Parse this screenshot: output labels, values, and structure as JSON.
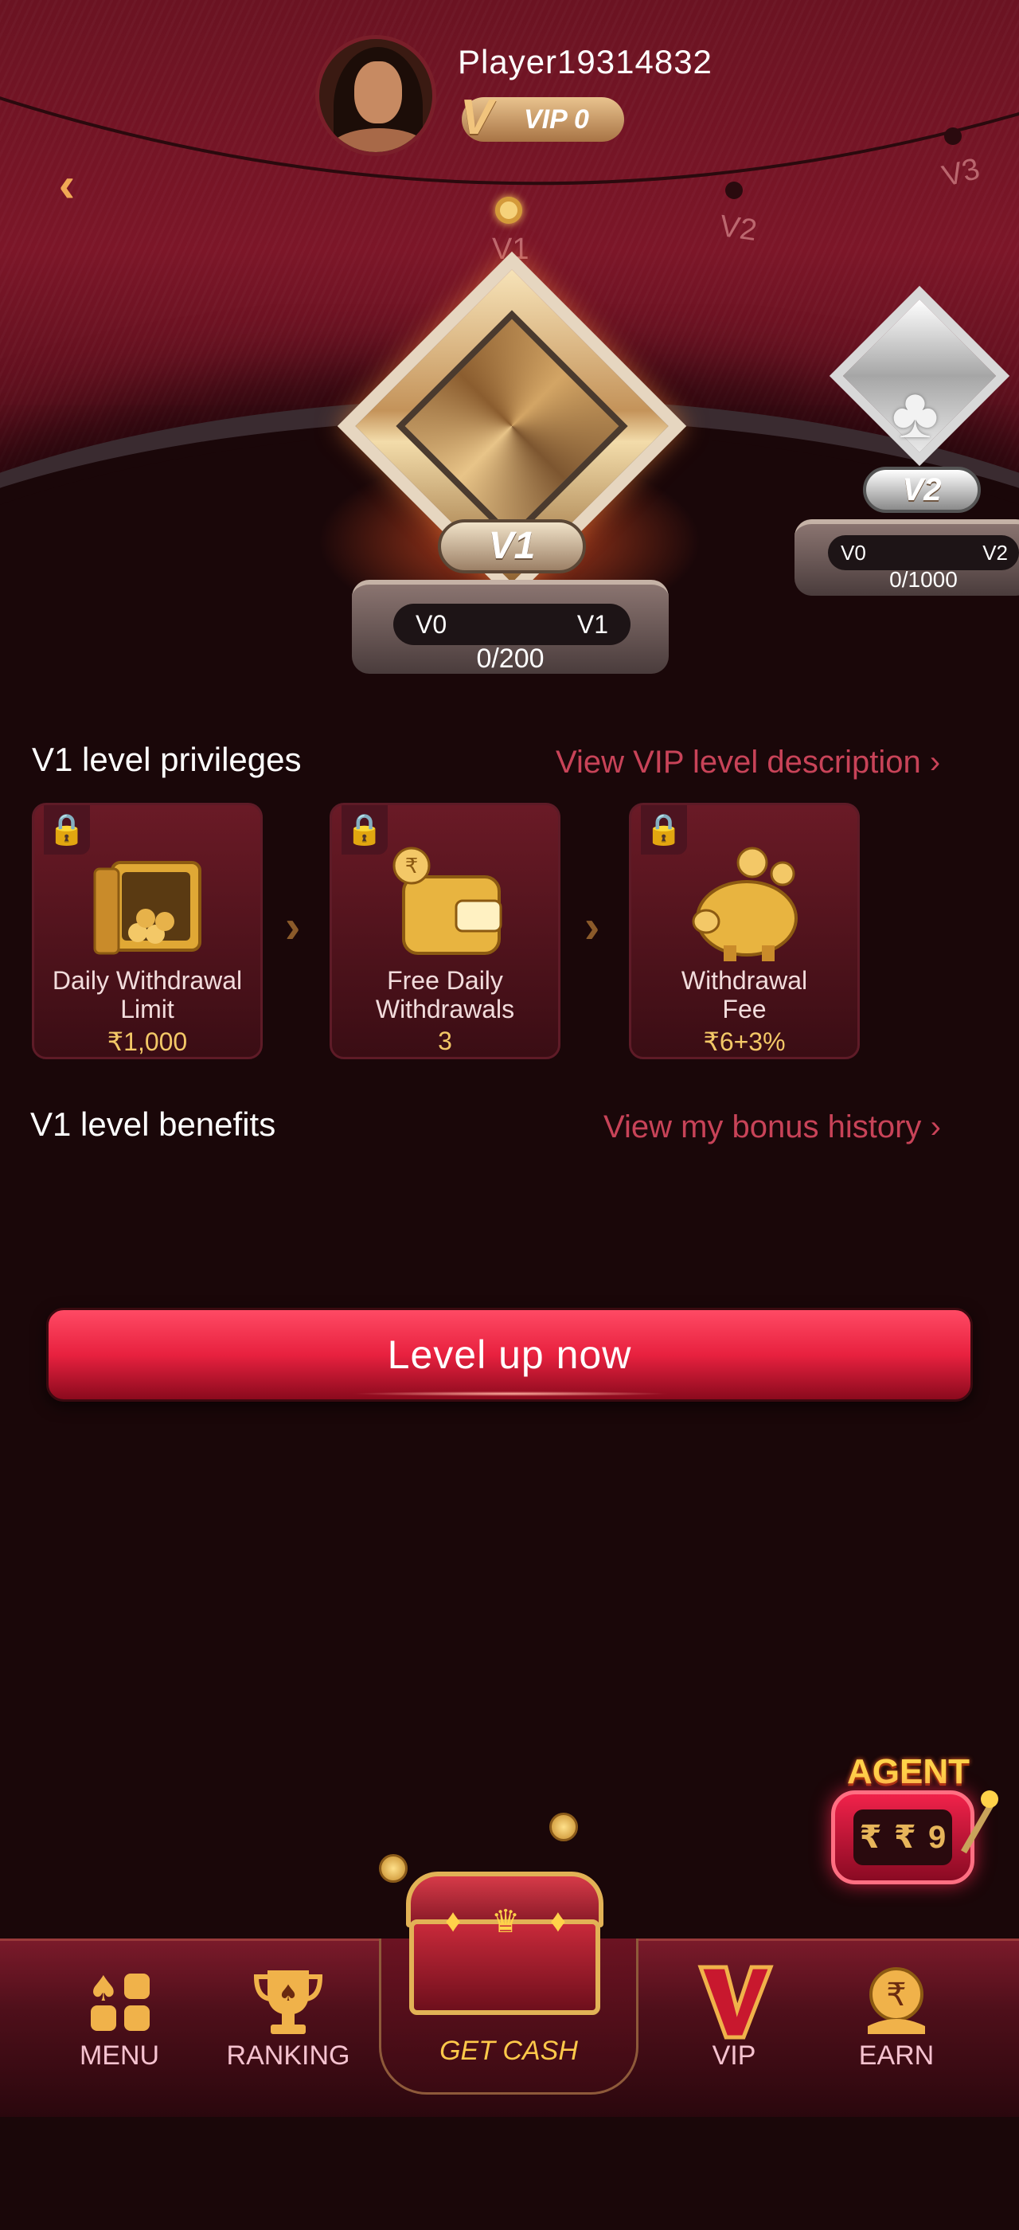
{
  "profile": {
    "username": "Player19314832",
    "vip_badge": "VIP 0",
    "vip_letter": "V"
  },
  "level_track": {
    "levels": [
      "V1",
      "V2",
      "V3"
    ],
    "current": "V1"
  },
  "current_level_card": {
    "badge": "V1",
    "from": "V0",
    "to": "V1",
    "progress": "0/200"
  },
  "next_level_card": {
    "badge": "V2",
    "from": "V0",
    "to": "V2",
    "progress": "0/1000"
  },
  "privileges": {
    "title": "V1 level privileges",
    "link": "View VIP level description",
    "items": [
      {
        "name_line1": "Daily Withdrawal",
        "name_line2": "Limit",
        "value": "₹1,000",
        "icon": "gold-safe-icon"
      },
      {
        "name_line1": "Free Daily",
        "name_line2": "Withdrawals",
        "value": "3",
        "icon": "gold-wallet-icon"
      },
      {
        "name_line1": "Withdrawal",
        "name_line2": "Fee",
        "value": "₹6+3%",
        "icon": "piggy-bank-icon"
      }
    ]
  },
  "benefits": {
    "title": "V1 level benefits",
    "link": "View my bonus history"
  },
  "cta": {
    "label": "Level up now"
  },
  "agent": {
    "label": "AGENT"
  },
  "nav": {
    "menu": "MENU",
    "ranking": "RANKING",
    "get_cash": "GET CASH",
    "vip": "VIP",
    "earn": "EARN"
  },
  "colors": {
    "accent_gold": "#f3c867",
    "link_red": "#c84358",
    "cta_red": "#e8213f"
  }
}
